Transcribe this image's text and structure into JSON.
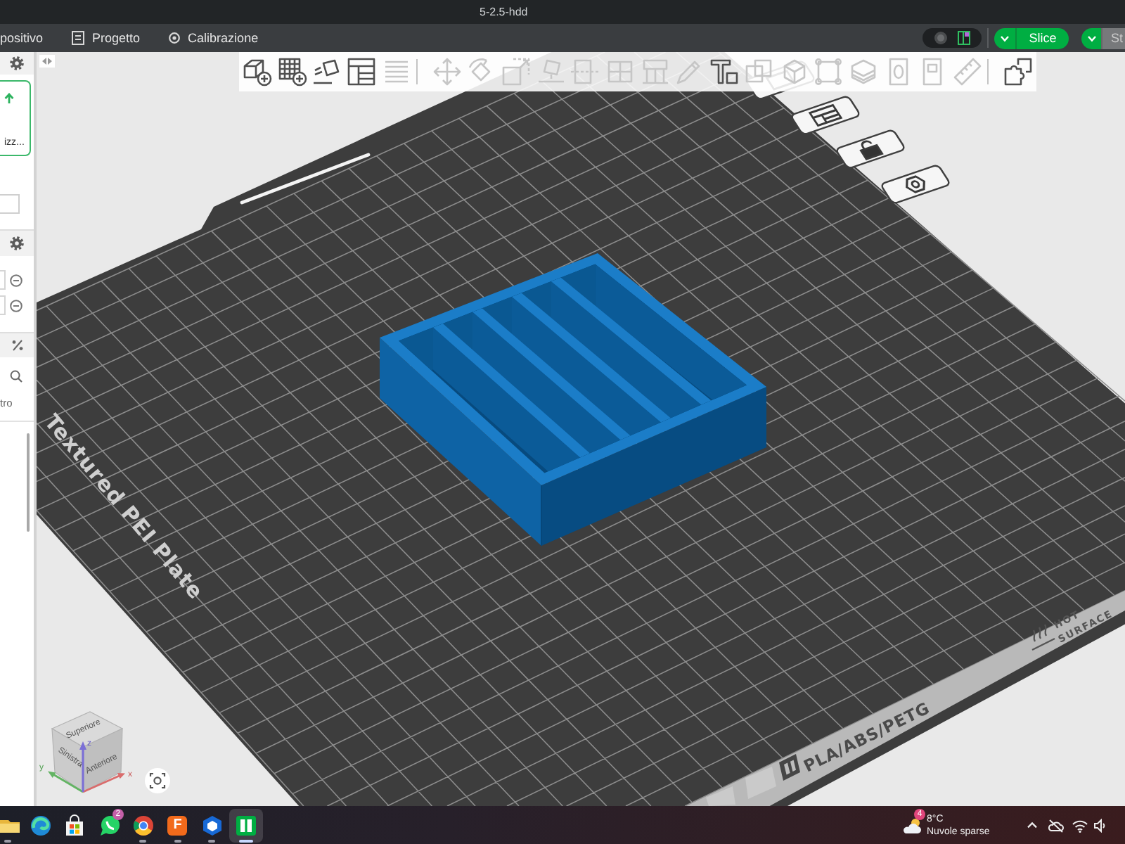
{
  "window": {
    "title": "5-2.5-hdd"
  },
  "menu_bar": {
    "tabs": [
      {
        "label": "positivo",
        "selected": false
      },
      {
        "label": "Progetto",
        "selected": false
      },
      {
        "label": "Calibrazione",
        "selected": false
      }
    ],
    "slice_button": {
      "label": "Slice"
    },
    "print_button": {
      "label": "St",
      "disabled": true
    }
  },
  "left_panel": {
    "preset_card": {
      "label": "izz...",
      "selected": true
    },
    "list_label": "tro"
  },
  "toolbar": {
    "items": [
      {
        "kind": "tool",
        "disabled": false
      },
      {
        "kind": "tool",
        "disabled": false
      },
      {
        "kind": "tool",
        "disabled": false
      },
      {
        "kind": "tool",
        "disabled": false
      },
      {
        "kind": "tool",
        "disabled": true
      },
      {
        "kind": "separator"
      },
      {
        "kind": "tool",
        "disabled": true
      },
      {
        "kind": "tool",
        "disabled": true
      },
      {
        "kind": "tool",
        "disabled": true
      },
      {
        "kind": "tool",
        "disabled": true
      },
      {
        "kind": "tool",
        "disabled": true
      },
      {
        "kind": "tool",
        "disabled": true
      },
      {
        "kind": "tool",
        "disabled": true
      },
      {
        "kind": "tool",
        "disabled": true
      },
      {
        "kind": "tool",
        "disabled": false
      },
      {
        "kind": "tool",
        "disabled": true
      },
      {
        "kind": "tool",
        "disabled": true
      },
      {
        "kind": "tool",
        "disabled": true
      },
      {
        "kind": "tool",
        "disabled": true
      },
      {
        "kind": "tool",
        "disabled": true
      },
      {
        "kind": "tool",
        "disabled": true
      },
      {
        "kind": "tool",
        "disabled": true
      },
      {
        "kind": "separator"
      },
      {
        "kind": "tool",
        "disabled": false
      }
    ]
  },
  "plate": {
    "label": "Textured PEI Plate",
    "material": "PLA/ABS/PETG",
    "warning": [
      "HOT",
      "SURFACE"
    ]
  },
  "view_cube": {
    "top": "Superiore",
    "left": "Sinistra",
    "front": "Anteriore",
    "axes": [
      "x",
      "y",
      "z"
    ]
  },
  "taskbar": {
    "apps": [
      {
        "selected": false,
        "running": true
      },
      {
        "selected": false,
        "running": false
      },
      {
        "selected": false,
        "running": false
      },
      {
        "selected": false,
        "running": false,
        "badge": "2"
      },
      {
        "selected": false,
        "running": true
      },
      {
        "selected": false,
        "running": true,
        "label": "F"
      },
      {
        "selected": false,
        "running": true
      },
      {
        "selected": true,
        "running": true
      }
    ],
    "weather": {
      "temperature": "8°C",
      "condition": "Nuvole sparse",
      "badge": "4"
    }
  }
}
